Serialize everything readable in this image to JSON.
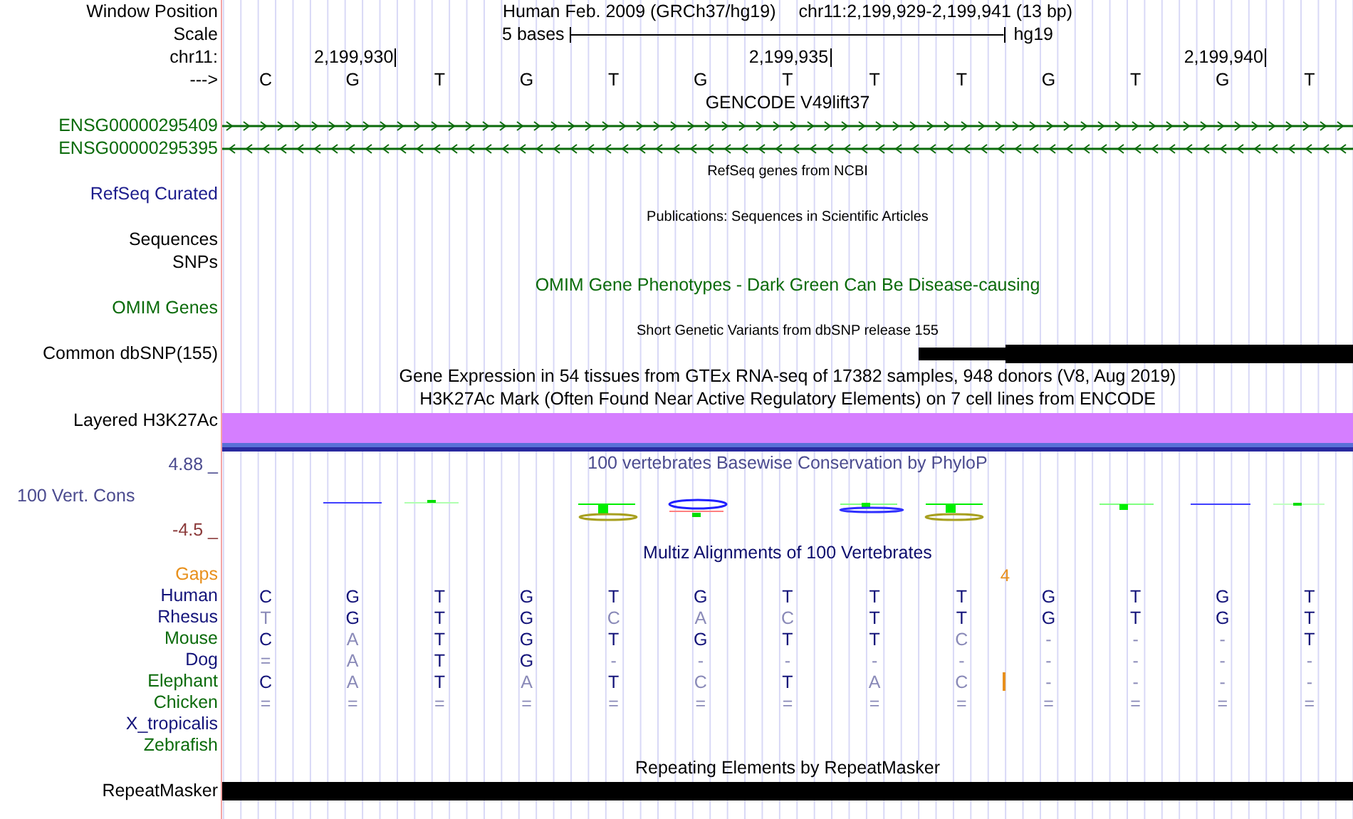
{
  "header": {
    "labels": [
      "Window Position",
      "Scale",
      "chr11:",
      "--->"
    ],
    "title": [
      "Human Feb. 2009 (GRCh37/hg19)",
      "chr11:2,199,929-2,199,941 (13 bp)"
    ],
    "scale": {
      "label": "5 bases",
      "assembly": "hg19"
    },
    "bases": [
      {
        "letter": "C"
      },
      {
        "letter": "G",
        "tick": "2,199,930"
      },
      {
        "letter": "T"
      },
      {
        "letter": "G"
      },
      {
        "letter": "T"
      },
      {
        "letter": "G"
      },
      {
        "letter": "T",
        "tick": "2,199,935"
      },
      {
        "letter": "T"
      },
      {
        "letter": "T"
      },
      {
        "letter": "G"
      },
      {
        "letter": "T"
      },
      {
        "letter": "G",
        "tick": "2,199,940"
      },
      {
        "letter": "T"
      }
    ]
  },
  "rows": [
    {
      "kind": "title",
      "text": "GENCODE V49lift37",
      "small": false,
      "color": "#000000"
    },
    {
      "kind": "gene",
      "label": "ENSG00000295409",
      "color": "#0b6b0b",
      "reverse": false
    },
    {
      "kind": "gene",
      "label": "ENSG00000295395",
      "color": "#0b6b0b",
      "reverse": true
    },
    {
      "kind": "title",
      "text": "RefSeq genes from NCBI",
      "small": true,
      "color": "#000000"
    },
    {
      "kind": "label",
      "label": "RefSeq Curated",
      "color": "#1c1c8c"
    },
    {
      "kind": "title",
      "text": "Publications: Sequences in Scientific Articles",
      "small": true,
      "color": "#000000"
    },
    {
      "kind": "label",
      "label": "Sequences",
      "color": "#000000"
    },
    {
      "kind": "label",
      "label": "SNPs",
      "color": "#000000"
    },
    {
      "kind": "title",
      "text": "OMIM Gene Phenotypes - Dark Green Can Be Disease-causing",
      "small": false,
      "color": "#0b6b0b"
    },
    {
      "kind": "label",
      "label": "OMIM Genes",
      "color": "#0b6b0b"
    },
    {
      "kind": "title",
      "text": "Short Genetic Variants from dbSNP release 155",
      "small": true,
      "color": "#000000"
    },
    {
      "kind": "features",
      "label": "Common dbSNP(155)",
      "color": "#000000"
    },
    {
      "kind": "title",
      "text": "Gene Expression in 54 tissues from GTEx RNA-seq of 17382 samples, 948 donors (V8, Aug 2019)",
      "small": false,
      "color": "#000000"
    },
    {
      "kind": "title",
      "text": "H3K27Ac Mark (Often Found Near Active Regulatory Elements) on 7 cell lines from ENCODE",
      "small": false,
      "color": "#000000"
    },
    {
      "kind": "signal",
      "label": "Layered H3K27Ac",
      "color": "#000000"
    },
    {
      "kind": "wiggle",
      "label": "100 Vert. Cons",
      "color": "#4b4b8f",
      "max": "4.88 _",
      "min": "-4.5 _",
      "title": "100 vertebrates Basewise Conservation by PhyloP"
    },
    {
      "kind": "title",
      "text": "Multiz Alignments of 100 Vertebrates",
      "small": false,
      "color": "#0c0c6c"
    },
    {
      "kind": "gaps",
      "label": "Gaps",
      "color": "#e8901c",
      "count": "4"
    },
    {
      "kind": "species",
      "label": "Human",
      "color": "#14147a",
      "insertion": false,
      "bases": [
        {
          "b": "C",
          "faded": false
        },
        {
          "b": "G",
          "faded": false
        },
        {
          "b": "T",
          "faded": false
        },
        {
          "b": "G",
          "faded": false
        },
        {
          "b": "T",
          "faded": false
        },
        {
          "b": "G",
          "faded": false
        },
        {
          "b": "T",
          "faded": false
        },
        {
          "b": "T",
          "faded": false
        },
        {
          "b": "T",
          "faded": false
        },
        {
          "b": "G",
          "faded": false
        },
        {
          "b": "T",
          "faded": false
        },
        {
          "b": "G",
          "faded": false
        },
        {
          "b": "T",
          "faded": false
        }
      ]
    },
    {
      "kind": "species",
      "label": "Rhesus",
      "color": "#14147a",
      "insertion": false,
      "bases": [
        {
          "b": "T",
          "faded": true
        },
        {
          "b": "G",
          "faded": false
        },
        {
          "b": "T",
          "faded": false
        },
        {
          "b": "G",
          "faded": false
        },
        {
          "b": "C",
          "faded": true
        },
        {
          "b": "A",
          "faded": true
        },
        {
          "b": "C",
          "faded": true
        },
        {
          "b": "T",
          "faded": false
        },
        {
          "b": "T",
          "faded": false
        },
        {
          "b": "G",
          "faded": false
        },
        {
          "b": "T",
          "faded": false
        },
        {
          "b": "G",
          "faded": false
        },
        {
          "b": "T",
          "faded": false
        }
      ]
    },
    {
      "kind": "species",
      "label": "Mouse",
      "color": "#0b6b0b",
      "insertion": false,
      "bases": [
        {
          "b": "C",
          "faded": false
        },
        {
          "b": "A",
          "faded": true
        },
        {
          "b": "T",
          "faded": false
        },
        {
          "b": "G",
          "faded": false
        },
        {
          "b": "T",
          "faded": false
        },
        {
          "b": "G",
          "faded": false
        },
        {
          "b": "T",
          "faded": false
        },
        {
          "b": "T",
          "faded": false
        },
        {
          "b": "C",
          "faded": true
        },
        {
          "b": "-",
          "faded": true
        },
        {
          "b": "-",
          "faded": true
        },
        {
          "b": "-",
          "faded": true
        },
        {
          "b": "T",
          "faded": false
        }
      ]
    },
    {
      "kind": "species",
      "label": "Dog",
      "color": "#14147a",
      "insertion": false,
      "bases": [
        {
          "b": "=",
          "faded": true
        },
        {
          "b": "A",
          "faded": true
        },
        {
          "b": "T",
          "faded": false
        },
        {
          "b": "G",
          "faded": false
        },
        {
          "b": "-",
          "faded": true
        },
        {
          "b": "-",
          "faded": true
        },
        {
          "b": "-",
          "faded": true
        },
        {
          "b": "-",
          "faded": true
        },
        {
          "b": "-",
          "faded": true
        },
        {
          "b": "-",
          "faded": true
        },
        {
          "b": "-",
          "faded": true
        },
        {
          "b": "-",
          "faded": true
        },
        {
          "b": "-",
          "faded": true
        }
      ]
    },
    {
      "kind": "species",
      "label": "Elephant",
      "color": "#0b6b0b",
      "insertion": true,
      "bases": [
        {
          "b": "C",
          "faded": false
        },
        {
          "b": "A",
          "faded": true
        },
        {
          "b": "T",
          "faded": false
        },
        {
          "b": "A",
          "faded": true
        },
        {
          "b": "T",
          "faded": false
        },
        {
          "b": "C",
          "faded": true
        },
        {
          "b": "T",
          "faded": false
        },
        {
          "b": "A",
          "faded": true
        },
        {
          "b": "C",
          "faded": true
        },
        {
          "b": "-",
          "faded": true
        },
        {
          "b": "-",
          "faded": true
        },
        {
          "b": "-",
          "faded": true
        },
        {
          "b": "-",
          "faded": true
        }
      ]
    },
    {
      "kind": "species",
      "label": "Chicken",
      "color": "#0b6b0b",
      "insertion": false,
      "bases": [
        {
          "b": "=",
          "faded": true
        },
        {
          "b": "=",
          "faded": true
        },
        {
          "b": "=",
          "faded": true
        },
        {
          "b": "=",
          "faded": true
        },
        {
          "b": "=",
          "faded": true
        },
        {
          "b": "=",
          "faded": true
        },
        {
          "b": "=",
          "faded": true
        },
        {
          "b": "=",
          "faded": true
        },
        {
          "b": "=",
          "faded": true
        },
        {
          "b": "=",
          "faded": true
        },
        {
          "b": "=",
          "faded": true
        },
        {
          "b": "=",
          "faded": true
        },
        {
          "b": "=",
          "faded": true
        }
      ]
    },
    {
      "kind": "species",
      "label": "X_tropicalis",
      "color": "#14147a"
    },
    {
      "kind": "species",
      "label": "Zebrafish",
      "color": "#0b6b0b"
    },
    {
      "kind": "title",
      "text": "Repeating Elements by RepeatMasker",
      "small": false,
      "color": "#000000"
    },
    {
      "kind": "features",
      "label": "RepeatMasker",
      "color": "#000000"
    }
  ]
}
